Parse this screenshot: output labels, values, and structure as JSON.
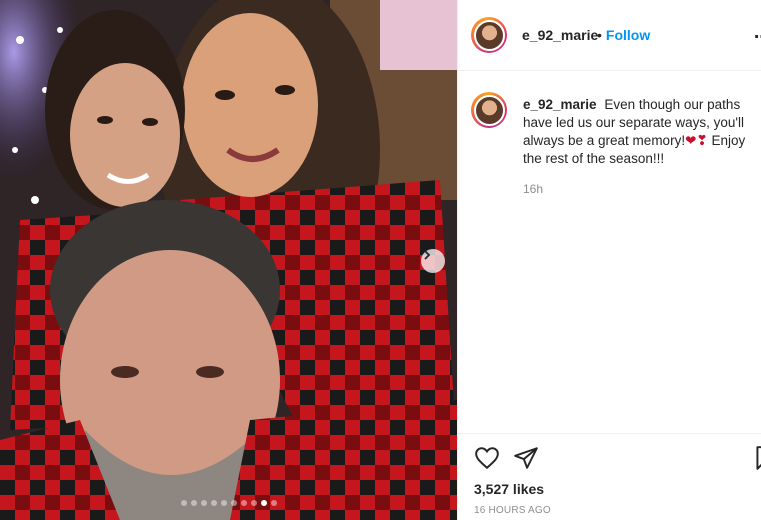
{
  "post": {
    "username": "e_92_marie",
    "follow_label": "Follow",
    "follow_separator": "•",
    "more_label": "⋯"
  },
  "caption": {
    "username": "e_92_marie",
    "text_part1": "Even though our paths have led us our separate ways, you'll always be a great memory!",
    "emoji": "❤❣",
    "text_part2": "Enjoy the rest of the season!!!",
    "age": "16h"
  },
  "stats": {
    "likes": "3,527 likes",
    "timestamp": "16 HOURS AGO"
  },
  "carousel": {
    "total": 10,
    "active_index": 8
  },
  "icons": {
    "like": "heart-icon",
    "share": "paper-plane-icon",
    "save": "bookmark-icon",
    "next": "chevron-right-icon"
  },
  "colors": {
    "accent_blue": "#0095f6",
    "text": "#262626",
    "muted": "#8e8e8e",
    "plaid_red": "#c4161c",
    "plaid_black": "#1a1a1a"
  }
}
